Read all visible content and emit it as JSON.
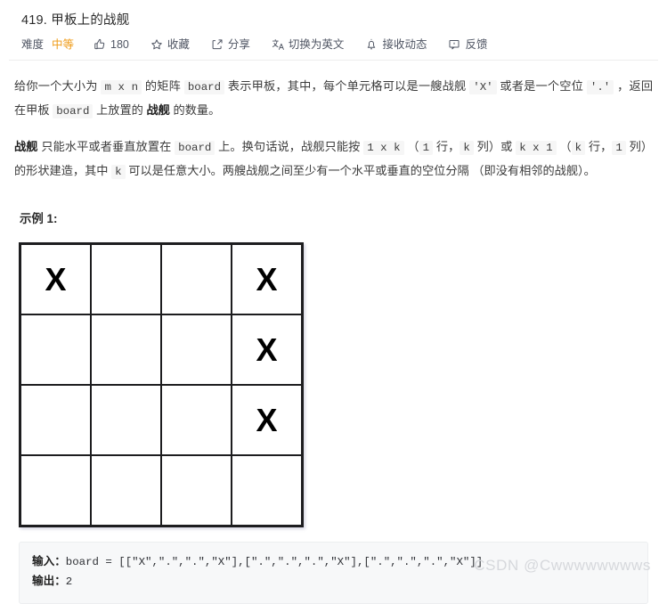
{
  "header": {
    "title": "419. 甲板上的战舰"
  },
  "toolbar": {
    "difficulty_label": "难度",
    "difficulty_value": "中等",
    "difficulty_color": "#ef9b17",
    "items": [
      {
        "icon": "thumbs-up-icon",
        "label": "180"
      },
      {
        "icon": "star-icon",
        "label": "收藏"
      },
      {
        "icon": "share-icon",
        "label": "分享"
      },
      {
        "icon": "translate-icon",
        "label": "切换为英文"
      },
      {
        "icon": "bell-icon",
        "label": "接收动态"
      },
      {
        "icon": "feedback-icon",
        "label": "反馈"
      }
    ]
  },
  "description": {
    "para1": {
      "t1": "给你一个大小为 ",
      "c1": "m x n",
      "t2": " 的矩阵 ",
      "c2": "board",
      "t3": " 表示甲板，其中，每个单元格可以是一艘战舰 ",
      "c3": "'X'",
      "t4": " 或者是一个空位 ",
      "c4": "'.'",
      "t5": " ，返回在甲板 ",
      "c5": "board",
      "t6": " 上放置的 ",
      "b1": "战舰",
      "t7": " 的数量。"
    },
    "para2": {
      "b1": "战舰",
      "t1": " 只能水平或者垂直放置在 ",
      "c1": "board",
      "t2": " 上。换句话说，战舰只能按 ",
      "c2": "1 x k",
      "t3": " （",
      "c3": "1",
      "t4": " 行，",
      "c4": "k",
      "t5": " 列）或 ",
      "c5": "k x 1",
      "t6": " （",
      "c6": "k",
      "t7": " 行，",
      "c7": "1",
      "t8": " 列）的形状建造，其中 ",
      "c8": "k",
      "t9": " 可以是任意大小。两艘战舰之间至少有一个水平或垂直的空位分隔 （即没有相邻的战舰）。"
    }
  },
  "example": {
    "heading": "示例 1:",
    "board": [
      [
        "X",
        "",
        "",
        "X"
      ],
      [
        "",
        "",
        "",
        "X"
      ],
      [
        "",
        "",
        "",
        "X"
      ],
      [
        "",
        "",
        "",
        ""
      ]
    ],
    "input_label": "输入：",
    "input_value": "board = [[\"X\",\".\",\".\",\"X\"],[\".\",\".\",\".\",\"X\"],[\".\",\".\",\".\",\"X\"]]",
    "output_label": "输出：",
    "output_value": "2"
  },
  "watermark": {
    "text": "CSDN @Cwwwwwwwws"
  }
}
